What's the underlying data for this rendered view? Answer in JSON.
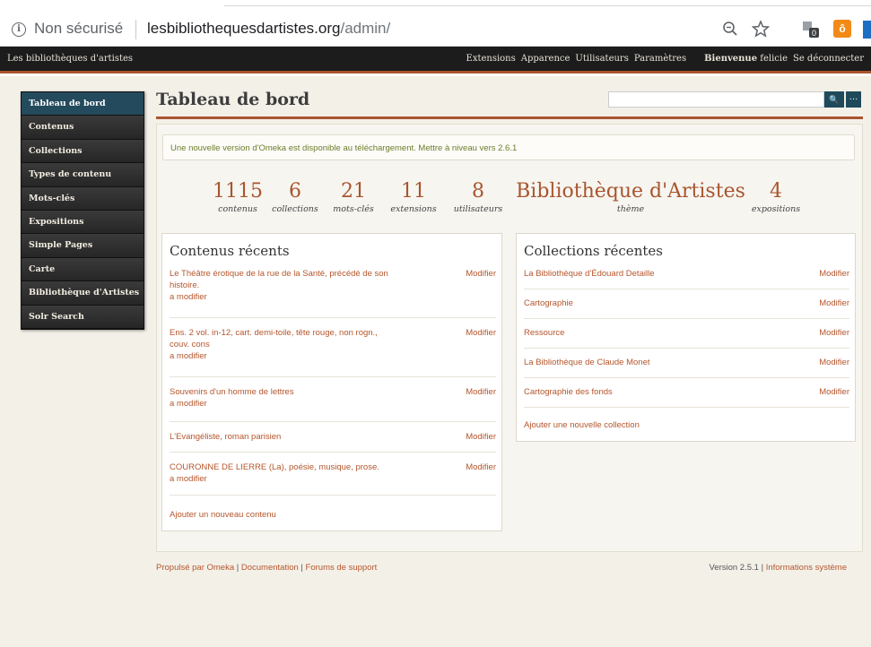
{
  "browser": {
    "not_secure": "Non sécurisé",
    "url_host": "lesbibliothequesdartistes.org",
    "url_path": "/admin/",
    "ext_badge": "0",
    "ext2_glyph": "ô"
  },
  "adminbar": {
    "site_title": "Les bibliothèques d'artistes",
    "nav": [
      "Extensions",
      "Apparence",
      "Utilisateurs",
      "Paramètres"
    ],
    "welcome": "Bienvenue",
    "user": "felicie",
    "logout": "Se déconnecter"
  },
  "sidebar": {
    "items": [
      {
        "label": "Tableau de bord",
        "active": true
      },
      {
        "label": "Contenus"
      },
      {
        "label": "Collections"
      },
      {
        "label": "Types de contenu"
      },
      {
        "label": "Mots-clés"
      },
      {
        "label": "Expositions"
      },
      {
        "label": "Simple Pages"
      },
      {
        "label": "Carte"
      },
      {
        "label": "Bibliothèque d'Artistes"
      },
      {
        "label": "Solr Search"
      }
    ]
  },
  "main": {
    "title": "Tableau de bord",
    "search_value": "",
    "search_glyph": "🔍",
    "advanced_glyph": "…",
    "alert": "Une nouvelle version d'Omeka est disponible au téléchargement. Mettre à niveau vers 2.6.1",
    "stats": [
      {
        "num": "1115",
        "label": "contenus"
      },
      {
        "num": "6",
        "label": "collections"
      },
      {
        "num": "21",
        "label": "mots-clés"
      },
      {
        "num": "11",
        "label": "extensions"
      },
      {
        "num": "8",
        "label": "utilisateurs"
      },
      {
        "num": "Bibliothèque d'Artistes",
        "label": "thème"
      },
      {
        "num": "4",
        "label": "expositions"
      }
    ],
    "recent_items": {
      "heading": "Contenus récents",
      "rows": [
        {
          "title": "Le Théâtre érotique de la rue de la Santé, précédé de son",
          "title2": "histoire.",
          "note": "a modifier",
          "edit": "Modifier"
        },
        {
          "title": "Ens. 2 vol. in-12, cart. demi-toile, tête rouge, non rogn.,",
          "title2": "couv. cons",
          "note": "a modifier",
          "edit": "Modifier"
        },
        {
          "title": "Souvenirs d'un homme de lettres",
          "title2": "",
          "note": "a modifier",
          "edit": "Modifier"
        },
        {
          "title": "L'Evangéliste, roman parisien",
          "title2": "",
          "note": "",
          "edit": "Modifier"
        },
        {
          "title": "COURONNE DE LIERRE (La), poésie, musique, prose.",
          "title2": "",
          "note": "a modifier",
          "edit": "Modifier"
        }
      ],
      "add_link": "Ajouter un nouveau contenu"
    },
    "recent_collections": {
      "heading": "Collections récentes",
      "rows": [
        {
          "title": "La Bibliothèque d'Édouard Detaille",
          "edit": "Modifier"
        },
        {
          "title": "Cartographie",
          "edit": "Modifier"
        },
        {
          "title": "Ressource",
          "edit": "Modifier"
        },
        {
          "title": "La Bibliothèque de Claude Monet",
          "edit": "Modifier"
        },
        {
          "title": "Cartographie des fonds",
          "edit": "Modifier"
        }
      ],
      "add_link": "Ajouter une nouvelle collection"
    }
  },
  "footer": {
    "powered": "Propulsé par Omeka",
    "docs": "Documentation",
    "forums": "Forums de support",
    "version": "Version 2.5.1",
    "sysinfo": "Informations système",
    "separator": "|"
  }
}
